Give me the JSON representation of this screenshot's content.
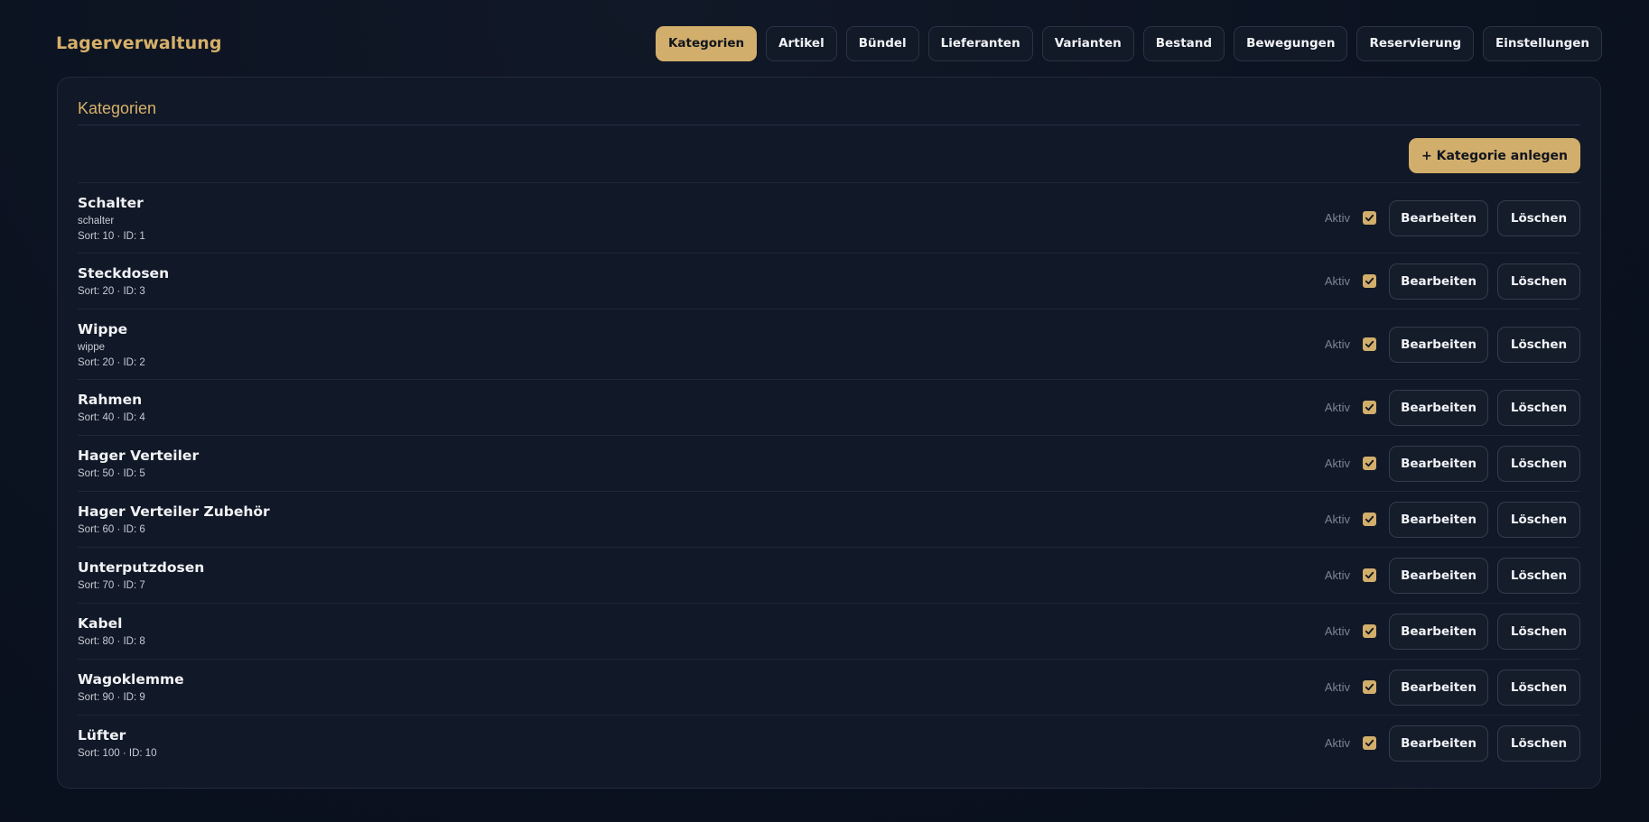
{
  "app": {
    "title": "Lagerverwaltung"
  },
  "nav": {
    "tabs": [
      {
        "label": "Kategorien",
        "active": true
      },
      {
        "label": "Artikel"
      },
      {
        "label": "Bündel"
      },
      {
        "label": "Lieferanten"
      },
      {
        "label": "Varianten"
      },
      {
        "label": "Bestand"
      },
      {
        "label": "Bewegungen"
      },
      {
        "label": "Reservierung"
      },
      {
        "label": "Einstellungen"
      }
    ]
  },
  "panel": {
    "title": "Kategorien",
    "add_label": "+ Kategorie anlegen"
  },
  "row_labels": {
    "aktiv": "Aktiv",
    "edit": "Bearbeiten",
    "delete": "Löschen"
  },
  "categories": [
    {
      "name": "Schalter",
      "slug": "schalter",
      "meta": "Sort: 10 · ID: 1",
      "active": true
    },
    {
      "name": "Steckdosen",
      "slug": "",
      "meta": "Sort: 20 · ID: 3",
      "active": true
    },
    {
      "name": "Wippe",
      "slug": "wippe",
      "meta": "Sort: 20 · ID: 2",
      "active": true
    },
    {
      "name": "Rahmen",
      "slug": "",
      "meta": "Sort: 40 · ID: 4",
      "active": true
    },
    {
      "name": "Hager Verteiler",
      "slug": "",
      "meta": "Sort: 50 · ID: 5",
      "active": true
    },
    {
      "name": "Hager Verteiler Zubehör",
      "slug": "",
      "meta": "Sort: 60 · ID: 6",
      "active": true
    },
    {
      "name": "Unterputzdosen",
      "slug": "",
      "meta": "Sort: 70 · ID: 7",
      "active": true
    },
    {
      "name": "Kabel",
      "slug": "",
      "meta": "Sort: 80 · ID: 8",
      "active": true
    },
    {
      "name": "Wagoklemme",
      "slug": "",
      "meta": "Sort: 90 · ID: 9",
      "active": true
    },
    {
      "name": "Lüfter",
      "slug": "",
      "meta": "Sort: 100 · ID: 10",
      "active": true
    }
  ],
  "colors": {
    "accent": "#d2ae6c",
    "background": "#0b1220",
    "panel": "#111827"
  }
}
